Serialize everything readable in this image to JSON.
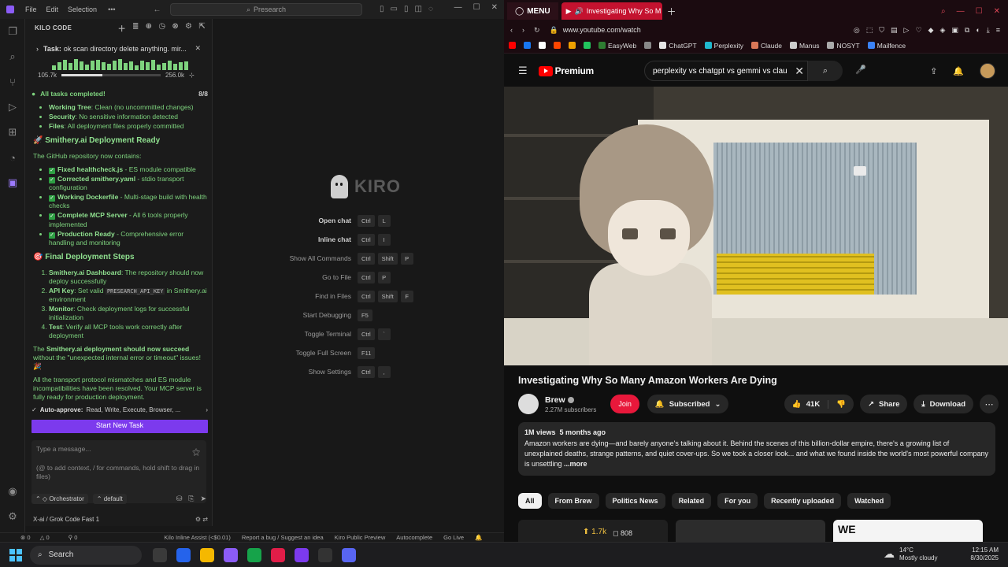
{
  "editor": {
    "menu": [
      "File",
      "Edit",
      "Selection"
    ],
    "search_placeholder": "Presearch",
    "panel_title": "KILO CODE",
    "task": {
      "label": "Task:",
      "text": "ok scan directory delete anything. mir...",
      "tokens_used": "105.7k",
      "tokens_max": "256.0k",
      "context_fraction": 0.41
    },
    "done_line": "All tasks completed!",
    "done_count": "8/8",
    "top_list": [
      {
        "key": "Working Tree",
        "val": ": Clean (no uncommitted changes)"
      },
      {
        "key": "Security",
        "val": ": No sensitive information detected"
      },
      {
        "key": "Files",
        "val": ": All deployment files properly committed"
      }
    ],
    "heading1": "Smithery.ai Deployment Ready",
    "para1": "The GitHub repository now contains:",
    "checks": [
      {
        "key": "Fixed healthcheck.js",
        "val": " - ES module compatible"
      },
      {
        "key": "Corrected smithery.yaml",
        "val": " - stdio transport configuration"
      },
      {
        "key": "Working Dockerfile",
        "val": " - Multi-stage build with health checks"
      },
      {
        "key": "Complete MCP Server",
        "val": " - All 6 tools properly implemented"
      },
      {
        "key": "Production Ready",
        "val": " - Comprehensive error handling and monitoring"
      }
    ],
    "heading2": "Final Deployment Steps",
    "steps": [
      {
        "key": "Smithery.ai Dashboard",
        "val": ": The repository should now deploy successfully"
      },
      {
        "key": "API Key",
        "val_pre": ": Set valid ",
        "code": "PRESEARCH_API_KEY",
        "val_post": " in Smithery.ai environment"
      },
      {
        "key": "Monitor",
        "val": ": Check deployment logs for successful initialization"
      },
      {
        "key": "Test",
        "val": ": Verify all MCP tools work correctly after deployment"
      }
    ],
    "para2_pre": "The ",
    "para2_bold": "Smithery.ai deployment should now succeed",
    "para2_post": " without the \"unexpected internal error or timeout\" issues! 🎉",
    "para3": "All the transport protocol mismatches and ES module incompatibilities have been resolved. Your MCP server is fully ready for production deployment.",
    "auto_approve_label": "Auto-approve:",
    "auto_approve_val": "Read, Write, Execute, Browser, ...",
    "new_task_label": "Start New Task",
    "msg_placeholder": "Type a message...",
    "msg_hint": "(@ to add context, / for commands, hold shift to drag in files)",
    "mode": "Orchestrator",
    "profile": "default",
    "model": "X-ai / Grok Code Fast 1",
    "kiro_word": "KIRO",
    "shortcuts": [
      {
        "label": "Open chat",
        "bold": true,
        "keys": [
          "Ctrl",
          "L"
        ]
      },
      {
        "label": "Inline chat",
        "bold": true,
        "keys": [
          "Ctrl",
          "I"
        ]
      },
      {
        "label": "Show All Commands",
        "bold": false,
        "keys": [
          "Ctrl",
          "Shift",
          "P"
        ]
      },
      {
        "label": "Go to File",
        "bold": false,
        "keys": [
          "Ctrl",
          "P"
        ]
      },
      {
        "label": "Find in Files",
        "bold": false,
        "keys": [
          "Ctrl",
          "Shift",
          "F"
        ]
      },
      {
        "label": "Start Debugging",
        "bold": false,
        "keys": [
          "F5"
        ]
      },
      {
        "label": "Toggle Terminal",
        "bold": false,
        "keys": [
          "Ctrl",
          "`"
        ]
      },
      {
        "label": "Toggle Full Screen",
        "bold": false,
        "keys": [
          "F11"
        ]
      },
      {
        "label": "Show Settings",
        "bold": false,
        "keys": [
          "Ctrl",
          ","
        ]
      }
    ],
    "status": {
      "errors": "0",
      "warnings": "0",
      "ports": "0",
      "assist": "Kilo Inline Assist (<$0.01)",
      "report": "Report a bug / Suggest an idea",
      "preview": "Kiro Public Preview",
      "autocomplete": "Autocomplete",
      "golive": "Go Live"
    }
  },
  "browser": {
    "menu_tab": "MENU",
    "active_tab": "Investigating Why So M",
    "url": "www.youtube.com/watch",
    "bookmarks": [
      {
        "label": "",
        "color": "#ff0000"
      },
      {
        "label": "",
        "color": "#1877f2"
      },
      {
        "label": "",
        "color": "#ffffff"
      },
      {
        "label": "",
        "color": "#ff4500"
      },
      {
        "label": "",
        "color": "#f0a000"
      },
      {
        "label": "",
        "color": "#22c55e"
      },
      {
        "label": "EasyWeb",
        "color": "#2e7d32"
      },
      {
        "label": "",
        "color": "#888888"
      },
      {
        "label": "ChatGPT",
        "color": "#e5e5e5"
      },
      {
        "label": "Perplexity",
        "color": "#20b8cd"
      },
      {
        "label": "Claude",
        "color": "#d97757"
      },
      {
        "label": "Manus",
        "color": "#cccccc"
      },
      {
        "label": "NOSYT",
        "color": "#aaaaaa"
      },
      {
        "label": "Mailfence",
        "color": "#3b82f6"
      }
    ],
    "yt_logo": "Premium",
    "search_value": "perplexity vs chatgpt vs gemmi vs clau",
    "video_title": "Investigating Why So Many Amazon Workers Are Dying",
    "channel": "Brew",
    "subscribers": "2.27M subscribers",
    "join": "Join",
    "subscribed": "Subscribed",
    "likes": "41K",
    "share": "Share",
    "download": "Download",
    "views": "1M views",
    "age": "5 months ago",
    "description": "Amazon workers are dying—and barely anyone's talking about it. Behind the scenes of this billion-dollar empire, there's a growing list of unexplained deaths, strange patterns, and quiet cover-ups. So we took a closer look... and what we found inside the world's most powerful company is unsettling",
    "more": "...more",
    "chips": [
      "All",
      "From Brew",
      "Politics News",
      "Related",
      "For you",
      "Recently uploaded",
      "Watched"
    ],
    "thumb1_likes": "1.7k",
    "thumb1_comments": "808",
    "thumb3_text": "WE"
  },
  "taskbar": {
    "search": "Search",
    "temp": "14°C",
    "weather": "Mostly cloudy",
    "time": "12:15 AM",
    "date": "8/30/2025",
    "apps": [
      {
        "name": "taskview",
        "color": "#3a3a3a"
      },
      {
        "name": "copilot",
        "color": "#2563eb"
      },
      {
        "name": "explorer",
        "color": "#f5b800"
      },
      {
        "name": "app-badged",
        "color": "#8b5cf6"
      },
      {
        "name": "app-green",
        "color": "#16a34a"
      },
      {
        "name": "opera",
        "color": "#e11d48"
      },
      {
        "name": "app-purple",
        "color": "#7c3aed"
      },
      {
        "name": "github",
        "color": "#333333"
      },
      {
        "name": "discord",
        "color": "#5865f2"
      }
    ]
  }
}
